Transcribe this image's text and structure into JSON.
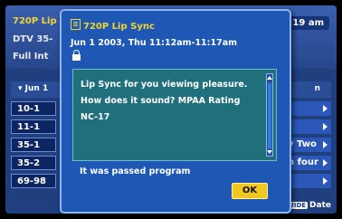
{
  "guide": {
    "channel_title": "720P Lip",
    "channel_sub": "DTV 35-",
    "full_info": "Full Int",
    "clock": "11:19 am",
    "date_label": "Jun 1",
    "date_right": "n",
    "rows": [
      {
        "channel": "10-1",
        "program": ""
      },
      {
        "channel": "11-1",
        "program": ""
      },
      {
        "channel": "35-1",
        "program": "y Two"
      },
      {
        "channel": "35-2",
        "program": "n four"
      },
      {
        "channel": "69-98",
        "program": ""
      }
    ],
    "footer_tag": "GUIDE",
    "footer_label": "Date"
  },
  "dialog": {
    "title": "720P Lip Sync",
    "time_line": "Jun 1 2003, Thu 11:12am-11:17am",
    "description": "Lip Sync for you viewing pleasure. How does it sound? MPAA Rating NC-17",
    "status": "It was passed program",
    "ok_label": "OK"
  },
  "colors": {
    "title_yellow": "#f2d430",
    "dialog_blue": "#1f58b4",
    "description_teal": "#1f6f7d",
    "ok_button": "#f0c81e"
  }
}
